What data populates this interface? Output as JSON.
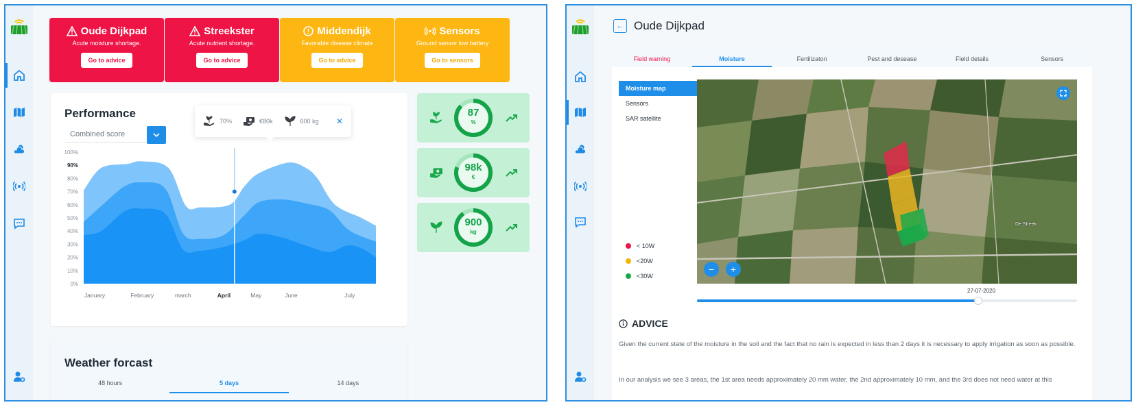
{
  "left": {
    "alerts": [
      {
        "title": "Oude Dijkpad",
        "desc": "Acute moisture shortage.",
        "button": "Go to advice",
        "color": "red",
        "icon": "warning-triangle-icon"
      },
      {
        "title": "Streekster",
        "desc": "Acute nutrient shortage.",
        "button": "Go to advice",
        "color": "red",
        "icon": "warning-triangle-icon"
      },
      {
        "title": "Middendijk",
        "desc": "Favorable disease climate",
        "button": "Go to advice",
        "color": "yellow",
        "icon": "alert-circle-icon"
      },
      {
        "title": "Sensors",
        "desc": "Ground sensor low battery",
        "button": "Go to sensors",
        "color": "yellow",
        "icon": "antenna-icon"
      }
    ],
    "performance": {
      "title": "Performance",
      "select_value": "Combined score",
      "tooltip": {
        "crop": "70%",
        "money": "€80k",
        "yield": "600 kg"
      }
    },
    "kpis": [
      {
        "value": "87",
        "unit": "%",
        "fraction": 0.87,
        "icon": "hand-plant-icon"
      },
      {
        "value": "98k",
        "unit": "€",
        "fraction": 0.8,
        "icon": "money-hand-icon"
      },
      {
        "value": "900",
        "unit": "kg",
        "fraction": 0.9,
        "icon": "sprout-icon"
      }
    ],
    "weather": {
      "title": "Weather forcast",
      "tabs": [
        "48 hours",
        "5 days",
        "14 days"
      ],
      "active_tab": 1
    }
  },
  "chart_data": {
    "type": "area",
    "x": [
      "January",
      "February",
      "march",
      "April",
      "May",
      "June",
      "July"
    ],
    "highlight": "April",
    "y_ticks": [
      "100%",
      "90%",
      "80%",
      "70%",
      "60%",
      "50%",
      "40%",
      "30%",
      "20%",
      "10%",
      "0%"
    ],
    "bold_tick": "90%",
    "ylim": [
      0,
      100
    ],
    "series": [
      {
        "color": "#7fc4fb",
        "points": [
          [
            0,
            71
          ],
          [
            0.3,
            88
          ],
          [
            0.75,
            91
          ],
          [
            1,
            93
          ],
          [
            1.45,
            88
          ],
          [
            1.75,
            59
          ],
          [
            2,
            58
          ],
          [
            2.5,
            60
          ],
          [
            2.75,
            74
          ],
          [
            3,
            84
          ],
          [
            3.5,
            92
          ],
          [
            3.8,
            88
          ],
          [
            4,
            80
          ],
          [
            4.3,
            60
          ],
          [
            4.75,
            50
          ],
          [
            5,
            44
          ]
        ]
      },
      {
        "color": "#3ea6f8",
        "points": [
          [
            0,
            47
          ],
          [
            0.3,
            59
          ],
          [
            0.7,
            74
          ],
          [
            1,
            77
          ],
          [
            1.4,
            72
          ],
          [
            1.7,
            38
          ],
          [
            2,
            34
          ],
          [
            2.4,
            37
          ],
          [
            2.75,
            52
          ],
          [
            3,
            62
          ],
          [
            3.4,
            64
          ],
          [
            3.8,
            61
          ],
          [
            4.2,
            56
          ],
          [
            4.5,
            42
          ],
          [
            4.75,
            36
          ],
          [
            5,
            32
          ]
        ]
      },
      {
        "color": "#1a93f6",
        "points": [
          [
            0,
            37
          ],
          [
            0.3,
            40
          ],
          [
            0.7,
            55
          ],
          [
            1,
            57
          ],
          [
            1.4,
            53
          ],
          [
            1.7,
            26
          ],
          [
            2,
            25
          ],
          [
            2.4,
            28
          ],
          [
            2.75,
            33
          ],
          [
            3,
            38
          ],
          [
            3.4,
            35
          ],
          [
            3.8,
            29
          ],
          [
            4.2,
            24
          ],
          [
            4.5,
            29
          ],
          [
            4.75,
            27
          ],
          [
            5,
            20
          ]
        ]
      }
    ],
    "cursor_x": 2.58,
    "cursor_y": 70
  },
  "right": {
    "title": "Oude Dijkpad",
    "tabs": [
      "Field warning",
      "Moisture",
      "Fertilizaton",
      "Pest and desease",
      "Field details",
      "Sensors"
    ],
    "active_tab": 1,
    "map_modes": [
      "Moisture map",
      "Sensors",
      "SAR satellite"
    ],
    "legend": [
      {
        "label": "< 10W",
        "color": "#ee1445"
      },
      {
        "label": "<20W",
        "color": "#f4b400"
      },
      {
        "label": "<30W",
        "color": "#18a84a"
      }
    ],
    "map_labels": [
      "De Streek"
    ],
    "date": "27-07-2020",
    "slider_fraction": 0.74,
    "advice_title": "ADVICE",
    "advice_p1": "Given the current state of the moisture in the soil and the fact that no rain is expected in less than 2 days it is necessary to apply irrigation as soon as possible.",
    "advice_p2": "In our analysis we see 3 areas, the 1st area needs approximately 20 mm water, the 2nd approximately 10 mm, and the 3rd does not need water at this"
  }
}
